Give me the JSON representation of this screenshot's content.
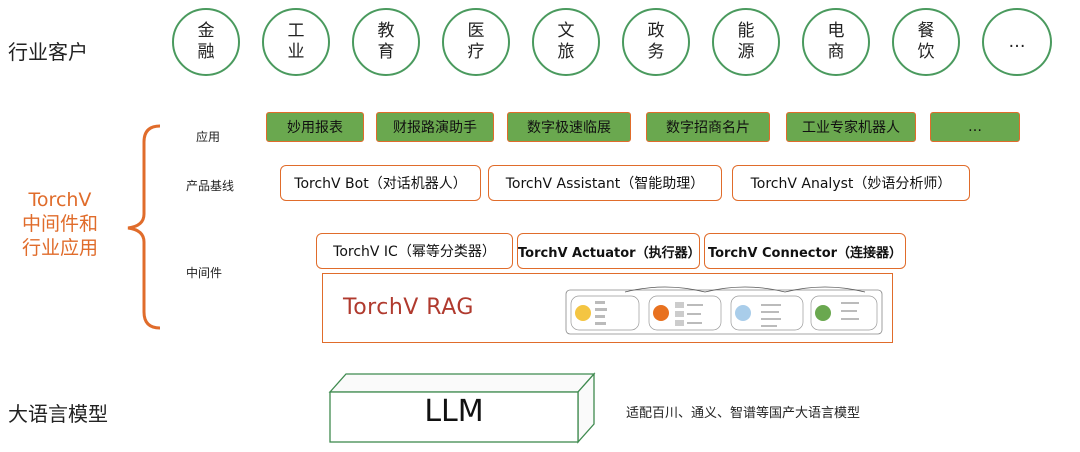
{
  "customers": {
    "label": "行业客户",
    "items": [
      "金融",
      "工业",
      "教育",
      "医疗",
      "文旅",
      "政务",
      "能源",
      "电商",
      "餐饮",
      "…"
    ]
  },
  "side": {
    "line1": "TorchV",
    "line2": "中间件和",
    "line3": "行业应用"
  },
  "layers": {
    "apps_label": "应用",
    "products_label": "产品基线",
    "middleware_label": "中间件"
  },
  "apps": [
    "妙用报表",
    "财报路演助手",
    "数字极速临展",
    "数字招商名片",
    "工业专家机器人",
    "…"
  ],
  "products": [
    "TorchV Bot（对话机器人）",
    "TorchV Assistant（智能助理）",
    "TorchV Analyst（妙语分析师）"
  ],
  "middleware": [
    "TorchV IC（幂等分类器）",
    "TorchV Actuator（执行器）",
    "TorchV Connector（连接器）"
  ],
  "rag": {
    "title": "TorchV RAG"
  },
  "llm": {
    "row_label": "大语言模型",
    "box": "LLM",
    "note": "适配百川、通义、智谱等国产大语言模型"
  },
  "colors": {
    "green": "#6aa84f",
    "orange": "#e06c2b",
    "circle": "#4a9a5e",
    "rag_title": "#b03a2e"
  }
}
